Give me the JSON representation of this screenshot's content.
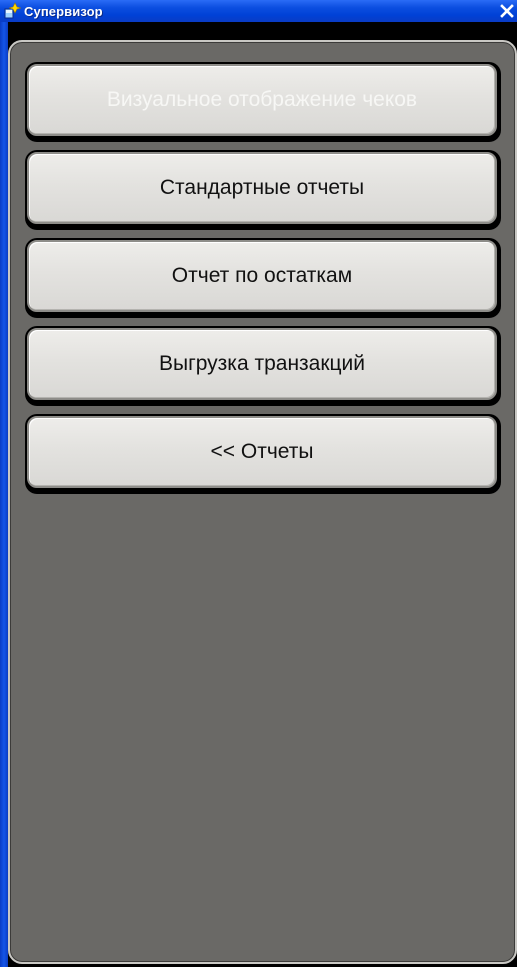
{
  "window": {
    "title": "Супервизор",
    "close_glyph": "✕"
  },
  "menu": {
    "buttons": [
      {
        "label": "Визуальное отображение чеков",
        "enabled": false
      },
      {
        "label": "Стандартные отчеты",
        "enabled": true
      },
      {
        "label": "Отчет по остаткам",
        "enabled": true
      },
      {
        "label": "Выгрузка транзакций",
        "enabled": true
      },
      {
        "label": "<< Отчеты",
        "enabled": true
      }
    ]
  },
  "colors": {
    "titlebar": "#0a46d8",
    "panel_background": "#6a6966",
    "button_face": "#e3e2df",
    "button_text": "#111111",
    "disabled_text": "#f7f7f5"
  },
  "icons": {
    "app": "app-icon",
    "close": "close-icon"
  }
}
